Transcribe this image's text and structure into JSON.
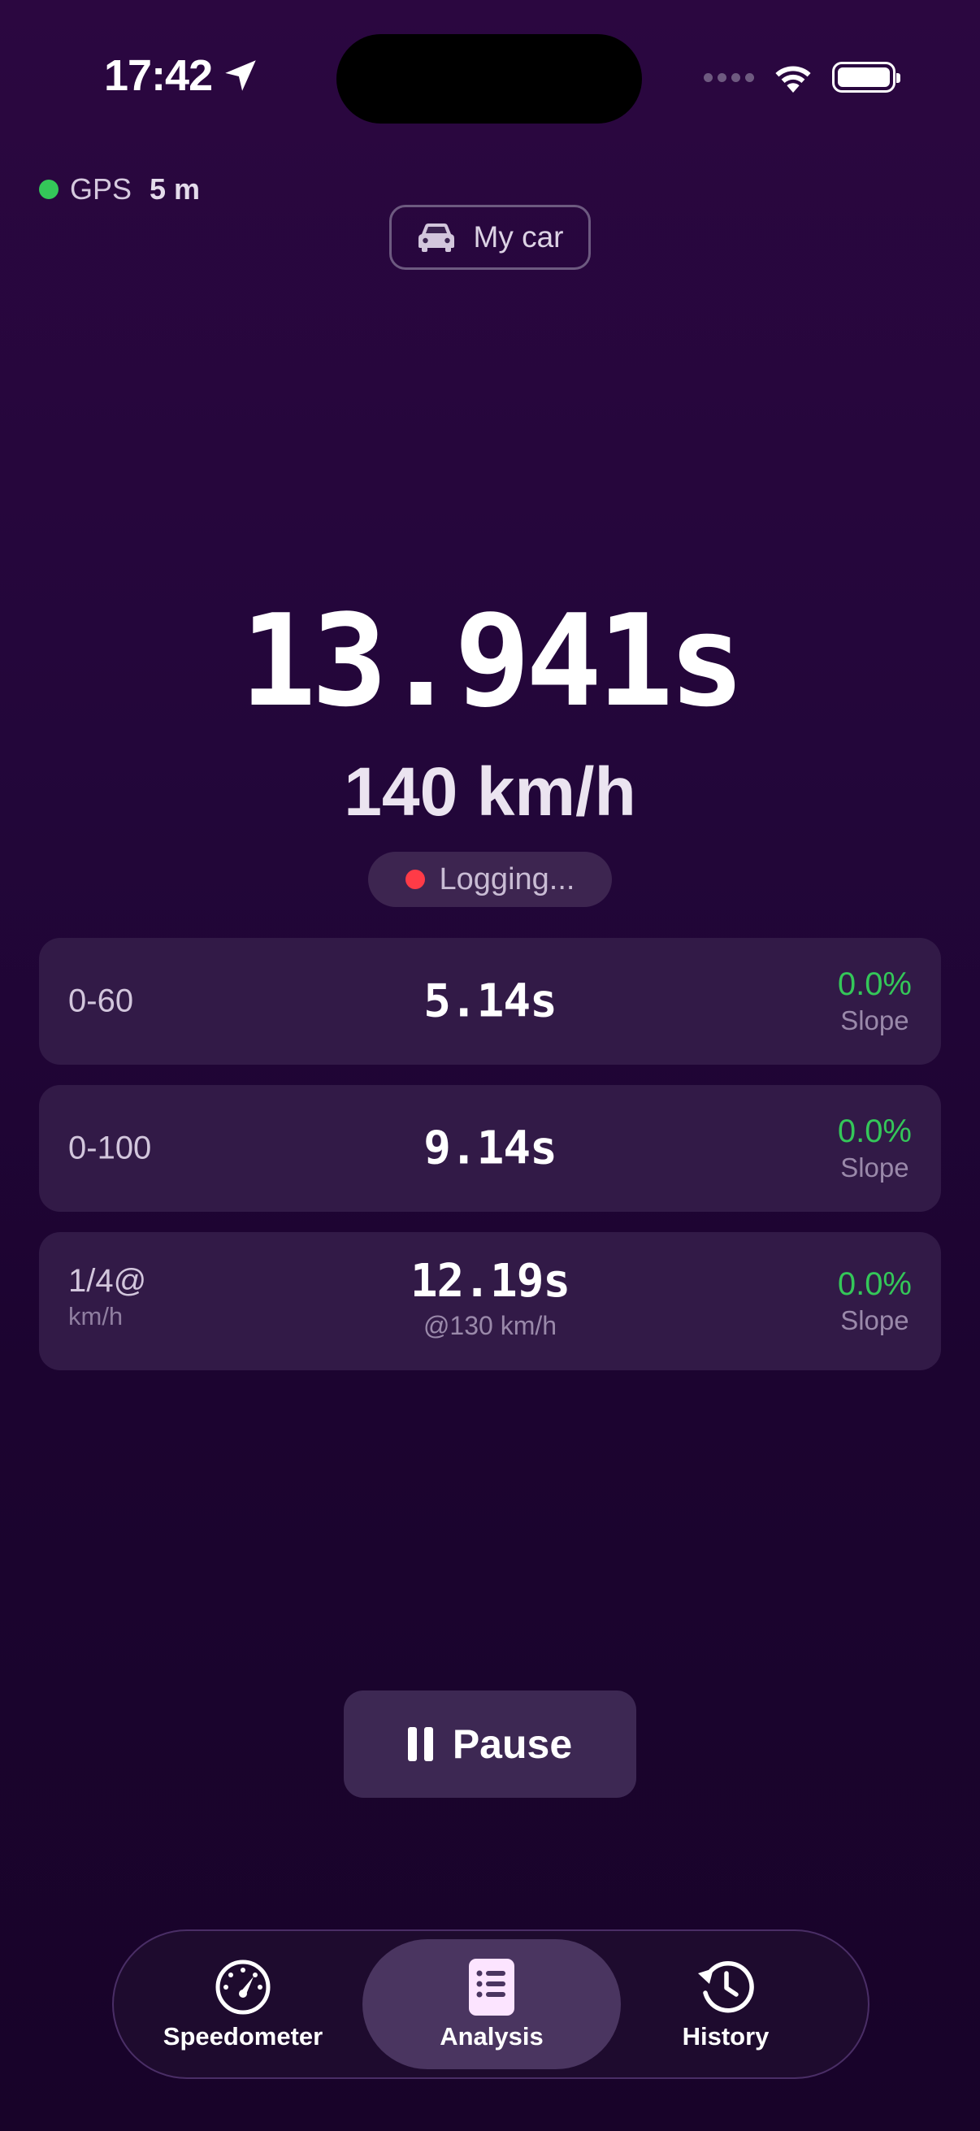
{
  "status_bar": {
    "time": "17:42"
  },
  "gps": {
    "label": "GPS",
    "accuracy": "5 m"
  },
  "vehicle": {
    "name": "My car"
  },
  "run": {
    "elapsed": "13.941s",
    "speed": "140 km/h",
    "state": "Logging..."
  },
  "results": [
    {
      "label": "0-60",
      "time": "5.14s",
      "slope": "0.0%",
      "slope_label": "Slope"
    },
    {
      "label": "0-100",
      "time": "9.14s",
      "slope": "0.0%",
      "slope_label": "Slope"
    },
    {
      "label": "1/4@",
      "label_sub": "km/h",
      "time": "12.19s",
      "time_sub": "@130 km/h",
      "slope": "0.0%",
      "slope_label": "Slope"
    }
  ],
  "controls": {
    "pause_label": "Pause"
  },
  "tabs": [
    {
      "label": "Speedometer",
      "icon": "speedometer-icon",
      "active": false
    },
    {
      "label": "Analysis",
      "icon": "document-list-icon",
      "active": true
    },
    {
      "label": "History",
      "icon": "history-clock-icon",
      "active": false
    }
  ],
  "colors": {
    "accent_green": "#34c759",
    "recording_red": "#ff3b47",
    "background_top": "#2b0740",
    "background_bottom": "#180329"
  }
}
